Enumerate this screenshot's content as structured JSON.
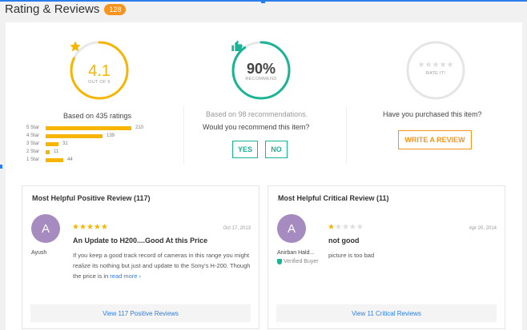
{
  "header": {
    "title": "Rating & Reviews",
    "count_badge": "128"
  },
  "rating": {
    "average": "4.1",
    "out_of": "OUT OF 5",
    "based_on": "Based on 435 ratings",
    "star_fraction": 0.82,
    "color": "#f7b500",
    "breakdown": [
      {
        "label": "5 Star",
        "count": "210",
        "fraction": 1.0
      },
      {
        "label": "4 Star",
        "count": "139",
        "fraction": 0.66
      },
      {
        "label": "3 Star",
        "count": "31",
        "fraction": 0.15
      },
      {
        "label": "2 Star",
        "count": "11",
        "fraction": 0.05
      },
      {
        "label": "1 Star",
        "count": "44",
        "fraction": 0.21
      }
    ]
  },
  "recommend": {
    "percent": "90%",
    "percent_value": 0.9,
    "label": "RECOMMEND",
    "based_on": "Based on 98 recommendations.",
    "question": "Would you recommend this item?",
    "yes_label": "YES",
    "no_label": "NO",
    "color": "#1ab394"
  },
  "rate_it": {
    "label": "RATE IT!",
    "question": "Have you purchased this item?",
    "write_label": "WRITE A REVIEW",
    "color": "#f7941d"
  },
  "positive_review": {
    "heading": "Most Helpful Positive Review (117)",
    "avatar_letter": "A",
    "reviewer": "Ayush",
    "stars": 5,
    "date": "Oct 17, 2013",
    "title": "An Update to H200....Good At this Price",
    "body": "If you keep a good track record of cameras in this range you might realize its nothing but just and update to the Sony's H-200. Though the price is in",
    "read_more": "read more ›",
    "footer_link": "View 117 Positive Reviews"
  },
  "critical_review": {
    "heading": "Most Helpful Critical Review (11)",
    "avatar_letter": "A",
    "reviewer": "Anirban Hald...",
    "verified": "Verified Buyer",
    "stars": 1,
    "date": "Apr 20, 2014",
    "title": "not good",
    "body": "picture is too bad",
    "footer_link": "View 11 Critical Reviews"
  },
  "icons": {
    "star": "star-icon",
    "thumbs_up": "thumbs-up-icon",
    "shield": "verified-shield-icon"
  }
}
